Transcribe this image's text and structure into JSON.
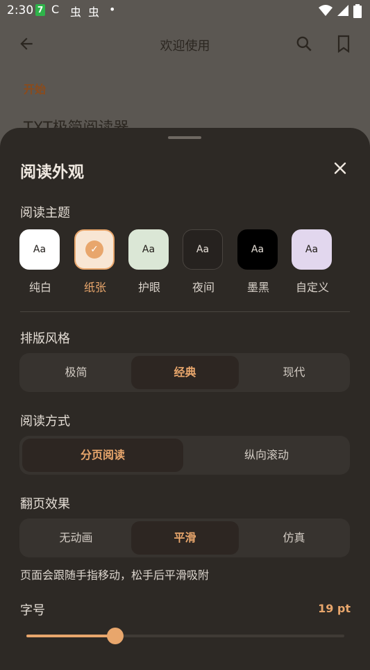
{
  "status_bar": {
    "time": "2:30",
    "badge": "7",
    "glyphs": [
      "C",
      "虫",
      "虫",
      "•"
    ]
  },
  "top_bar": {
    "title": "欢迎使用"
  },
  "background": {
    "section": "开始",
    "heading": "TXT极简阅读器"
  },
  "sheet": {
    "title": "阅读外观",
    "theme_section": "阅读主题",
    "themes": [
      {
        "label": "纯白",
        "sample": "Aa",
        "bg": "#ffffff",
        "fg": "#1f1b17",
        "border": "#ffffff",
        "selected": false
      },
      {
        "label": "纸张",
        "sample": "✓",
        "bg": "#f8e6d4",
        "fg": "#ffffff",
        "border": "#e8a66c",
        "selected": true
      },
      {
        "label": "护眼",
        "sample": "Aa",
        "bg": "#dbe7d6",
        "fg": "#1f1b17",
        "border": "#dbe7d6",
        "selected": false
      },
      {
        "label": "夜间",
        "sample": "Aa",
        "bg": "#26221f",
        "fg": "#e7e0d8",
        "border": "#4a4540",
        "selected": false
      },
      {
        "label": "墨黑",
        "sample": "Aa",
        "bg": "#000000",
        "fg": "#e7e0d8",
        "border": "#000000",
        "selected": false
      },
      {
        "label": "自定义",
        "sample": "Aa",
        "bg": "#e2d7ee",
        "fg": "#1f1b17",
        "border": "#e2d7ee",
        "selected": false
      }
    ],
    "layout_section": "排版风格",
    "layout_options": [
      "极简",
      "经典",
      "现代"
    ],
    "layout_selected": 1,
    "mode_section": "阅读方式",
    "mode_options": [
      "分页阅读",
      "纵向滚动"
    ],
    "mode_selected": 0,
    "flip_section": "翻页效果",
    "flip_options": [
      "无动画",
      "平滑",
      "仿真"
    ],
    "flip_selected": 1,
    "flip_hint": "页面会跟随手指移动，松手后平滑吸附",
    "font_size_section": "字号",
    "font_size_value": "19 pt",
    "font_size_fraction": 0.28
  },
  "colors": {
    "accent": "#e8a66c",
    "sheet_bg": "#2d2925",
    "scrim_bg": "#5b5752"
  },
  "icons": [
    "back-arrow-icon",
    "search-icon",
    "bookmark-icon",
    "close-icon",
    "wifi-icon",
    "signal-icon",
    "battery-icon",
    "check-icon"
  ]
}
